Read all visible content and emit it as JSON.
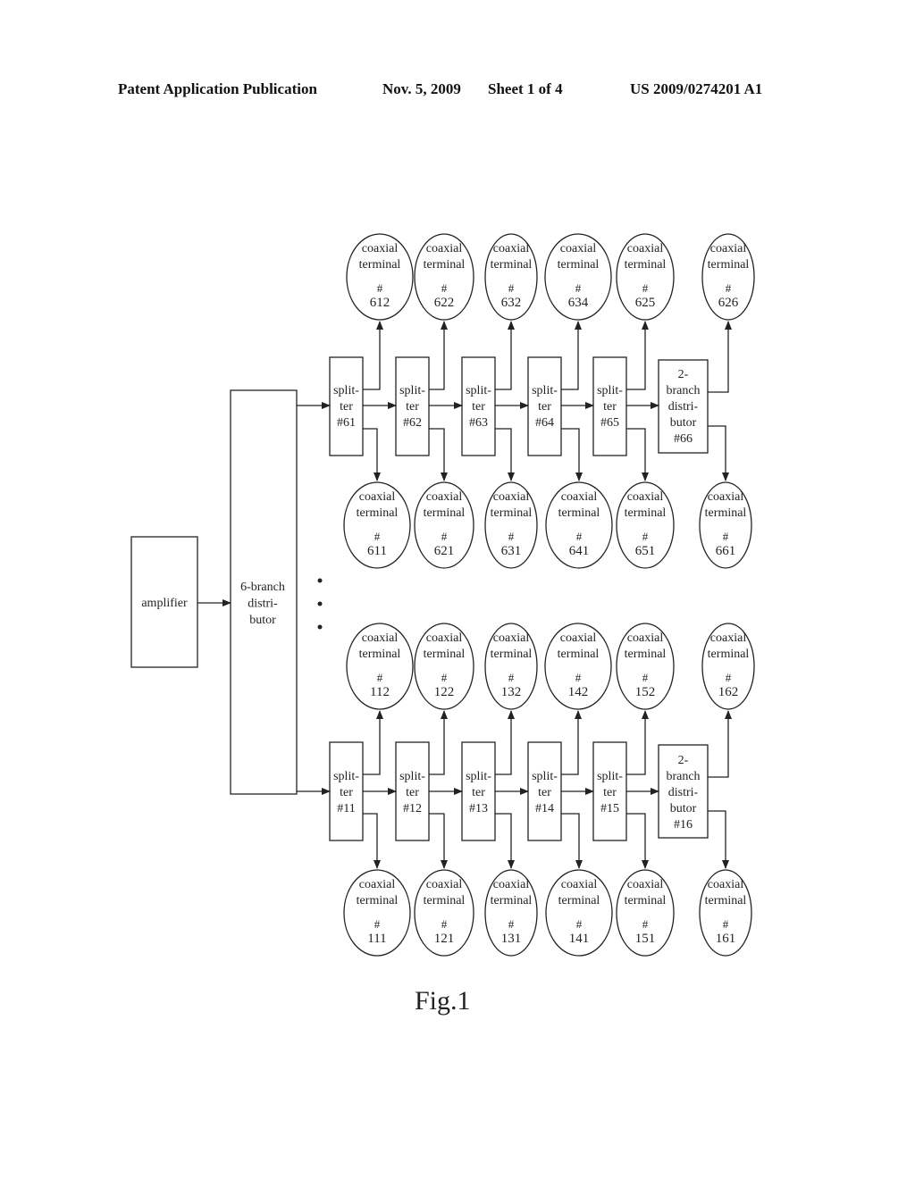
{
  "header": {
    "publication": "Patent Application Publication",
    "date": "Nov. 5, 2009",
    "sheet": "Sheet 1 of 4",
    "number": "US 2009/0274201 A1"
  },
  "figure_label": "Fig.1",
  "amplifier": {
    "label": "amplifier"
  },
  "distributor6": {
    "lines": [
      "6-branch",
      "distri-",
      "butor"
    ]
  },
  "ellipsis_dots": 3,
  "groups": [
    {
      "name": "group-6",
      "splitters": [
        {
          "lines": [
            "split-",
            "ter",
            "#61"
          ]
        },
        {
          "lines": [
            "split-",
            "ter",
            "#62"
          ]
        },
        {
          "lines": [
            "split-",
            "ter",
            "#63"
          ]
        },
        {
          "lines": [
            "split-",
            "ter",
            "#64"
          ]
        },
        {
          "lines": [
            "split-",
            "ter",
            "#65"
          ]
        },
        {
          "lines": [
            "2-",
            "branch",
            "distri-",
            "butor",
            "#66"
          ]
        }
      ],
      "top_terminals": [
        "612",
        "622",
        "632",
        "634",
        "625",
        "626"
      ],
      "bottom_terminals": [
        "611",
        "621",
        "631",
        "641",
        "651",
        "661"
      ]
    },
    {
      "name": "group-1",
      "splitters": [
        {
          "lines": [
            "split-",
            "ter",
            "#11"
          ]
        },
        {
          "lines": [
            "split-",
            "ter",
            "#12"
          ]
        },
        {
          "lines": [
            "split-",
            "ter",
            "#13"
          ]
        },
        {
          "lines": [
            "split-",
            "ter",
            "#14"
          ]
        },
        {
          "lines": [
            "split-",
            "ter",
            "#15"
          ]
        },
        {
          "lines": [
            "2-",
            "branch",
            "distri-",
            "butor",
            "#16"
          ]
        }
      ],
      "top_terminals": [
        "112",
        "122",
        "132",
        "142",
        "152",
        "162"
      ],
      "bottom_terminals": [
        "111",
        "121",
        "131",
        "141",
        "151",
        "161"
      ]
    }
  ],
  "terminal_text": {
    "line1": "coaxial",
    "line2": "terminal",
    "hash": "#"
  },
  "colors": {
    "ink": "#222222",
    "paper": "#ffffff"
  }
}
